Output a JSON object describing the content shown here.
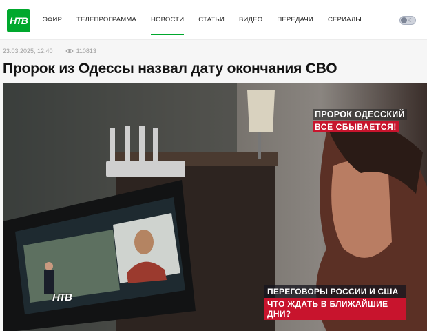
{
  "header": {
    "logo_text": "НТВ",
    "nav": [
      {
        "label": "ЭФИР"
      },
      {
        "label": "ТЕЛЕПРОГРАММА"
      },
      {
        "label": "НОВОСТИ",
        "active": true
      },
      {
        "label": "СТАТЬИ"
      },
      {
        "label": "ВИДЕО"
      },
      {
        "label": "ПЕРЕДАЧИ"
      },
      {
        "label": "СЕРИАЛЫ"
      }
    ],
    "theme_toggle_icon": "moon-icon"
  },
  "article": {
    "date": "23.03.2025, 12:40",
    "views": "110813",
    "title": "Пророк из Одессы назвал дату окончания СВО"
  },
  "video": {
    "caption_top_line1": "ПРОРОК ОДЕССКИЙ",
    "caption_top_line2": "ВСЕ СБЫВАЕТСЯ!",
    "caption_bottom_line1": "ПЕРЕГОВОРЫ РОССИИ И США",
    "caption_bottom_line2": "ЧТО ЖДАТЬ В БЛИЖАЙШИЕ ДНИ?",
    "channel_bug": "НТВ"
  },
  "colors": {
    "brand": "#00a82d",
    "caption_red": "#c8142d"
  }
}
